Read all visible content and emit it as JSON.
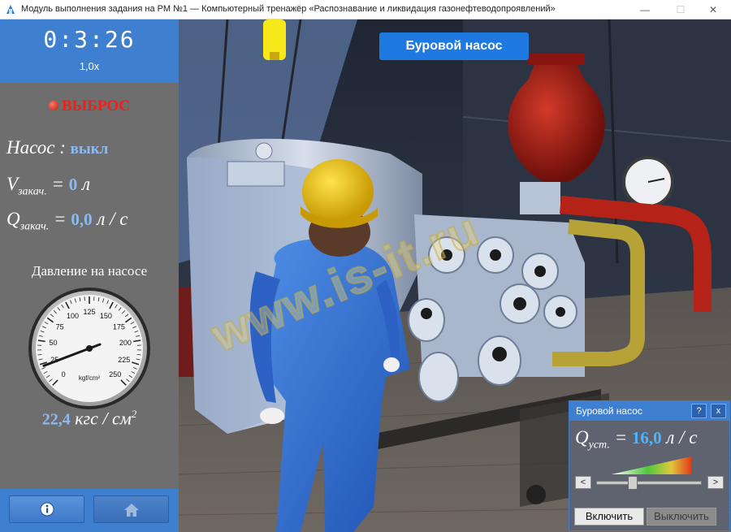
{
  "window": {
    "title": "Модуль выполнения задания на РМ №1 — Компьютерный тренажёр «Распознавание и ликвидация газонефтеводопроявлений»",
    "minimize_glyph": "—",
    "maximize_glyph": "☐",
    "close_glyph": "✕"
  },
  "left_panel": {
    "timer": "0:3:26",
    "speed": "1,0x",
    "alarm": "ВЫБРОС",
    "pump_label": "Насос",
    "pump_colon": ":",
    "pump_state": "выкл",
    "volume_symbol": "V",
    "volume_sub": "закач.",
    "volume_eq": "=",
    "volume_value": "0",
    "volume_unit": "л",
    "flow_symbol": "Q",
    "flow_sub": "закач.",
    "flow_eq": "=",
    "flow_value": "0,0",
    "flow_unit": "л / с",
    "gauge_title": "Давление на насосе",
    "gauge_unit": "kgf/cm²",
    "gauge_ticks": [
      "0",
      "25",
      "50",
      "75",
      "100",
      "125",
      "150",
      "175",
      "200",
      "225",
      "250"
    ],
    "gauge_value": 22.4,
    "gauge_max": 250,
    "pressure_value": "22,4",
    "pressure_unit": "кгс / см",
    "pressure_unit_sup": "2",
    "info_icon": "info-icon",
    "home_icon": "home-icon"
  },
  "scene": {
    "label": "Буровой насос",
    "watermark": "www.is-it.ru"
  },
  "control_panel": {
    "title": "Буровой насос",
    "help": "?",
    "close": "x",
    "q_symbol": "Q",
    "q_sub": "уст.",
    "q_eq": "=",
    "q_value": "16,0",
    "q_unit": "л / с",
    "minus": "<",
    "plus": ">",
    "slider_level": 0.33,
    "on_label": "Включить",
    "off_label": "Выключить"
  }
}
